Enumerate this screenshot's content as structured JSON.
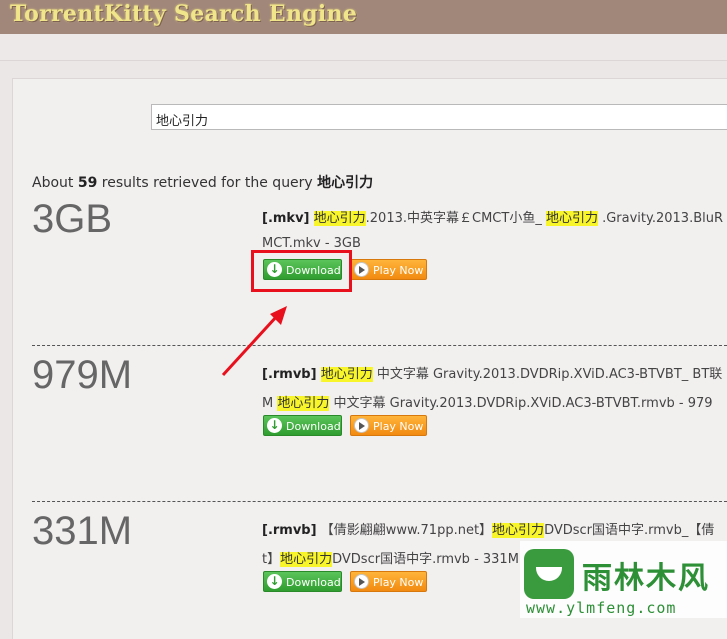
{
  "header": {
    "title": "TorrentKitty Search Engine"
  },
  "search": {
    "value": "地心引力"
  },
  "summary": {
    "prefix": "About ",
    "count": "59",
    "middle": " results retrieved for the query ",
    "query": "地心引力"
  },
  "results": [
    {
      "size": "3GB",
      "line1": [
        {
          "t": "[.mkv]",
          "k": "ext"
        },
        {
          "t": " ",
          "k": ""
        },
        {
          "t": "地心引力",
          "k": "hl"
        },
        {
          "t": ".2013.中英字幕￡CMCT小鱼_ ",
          "k": ""
        },
        {
          "t": "地心引力",
          "k": "hl"
        },
        {
          "t": " .Gravity.2013.BluR",
          "k": ""
        }
      ],
      "line2": [
        {
          "t": "MCT.mkv - 3GB",
          "k": ""
        }
      ],
      "download_label": "Download",
      "play_label": "Play Now"
    },
    {
      "size": "979M",
      "line1": [
        {
          "t": "[.rmvb]",
          "k": "ext"
        },
        {
          "t": " ",
          "k": ""
        },
        {
          "t": "地心引力",
          "k": "hl"
        },
        {
          "t": " 中文字幕 Gravity.2013.DVDRip.XViD.AC3-BTVBT_ BT联",
          "k": ""
        }
      ],
      "line2": [
        {
          "t": "M ",
          "k": ""
        },
        {
          "t": "地心引力",
          "k": "hl"
        },
        {
          "t": " 中文字幕 Gravity.2013.DVDRip.XViD.AC3-BTVBT.rmvb - 979",
          "k": ""
        }
      ],
      "download_label": "Download",
      "play_label": "Play Now"
    },
    {
      "size": "331M",
      "line1": [
        {
          "t": "[.rmvb]",
          "k": "ext"
        },
        {
          "t": " 【倩影翩翩www.71pp.net】",
          "k": ""
        },
        {
          "t": "地心引力",
          "k": "hl"
        },
        {
          "t": "DVDscr国语中字.rmvb_【倩",
          "k": ""
        }
      ],
      "line2": [
        {
          "t": "t】",
          "k": ""
        },
        {
          "t": "地心引力",
          "k": "hl"
        },
        {
          "t": "DVDscr国语中字.rmvb - 331M",
          "k": ""
        }
      ],
      "download_label": "Download",
      "play_label": "Play Now"
    }
  ],
  "watermark": {
    "name": "雨林木风",
    "url": "www.ylmfeng.com"
  },
  "colors": {
    "header": "#a0877a",
    "highlight": "#f8f52a",
    "download": "#3aa93a",
    "play": "#f28a10",
    "annotation": "#e8101c"
  }
}
